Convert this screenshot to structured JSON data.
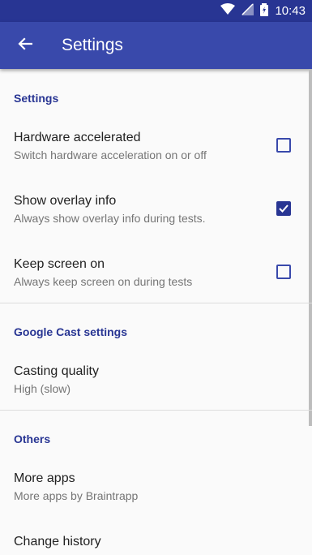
{
  "status_bar": {
    "time": "10:43"
  },
  "app_bar": {
    "title": "Settings"
  },
  "sections": {
    "settings": {
      "header": "Settings",
      "hardware": {
        "title": "Hardware accelerated",
        "summary": "Switch hardware acceleration on or off",
        "checked": false
      },
      "overlay": {
        "title": "Show overlay info",
        "summary": "Always show overlay info during tests.",
        "checked": true
      },
      "screen": {
        "title": "Keep screen on",
        "summary": "Always keep screen on during tests",
        "checked": false
      }
    },
    "cast": {
      "header": "Google Cast settings",
      "quality": {
        "title": "Casting quality",
        "summary": "High (slow)"
      }
    },
    "others": {
      "header": "Others",
      "more_apps": {
        "title": "More apps",
        "summary": "More apps by Braintrapp"
      },
      "change_history": {
        "title": "Change history"
      }
    }
  },
  "colors": {
    "primary": "#3949ab",
    "primary_dark": "#283593",
    "accent": "#283593"
  }
}
